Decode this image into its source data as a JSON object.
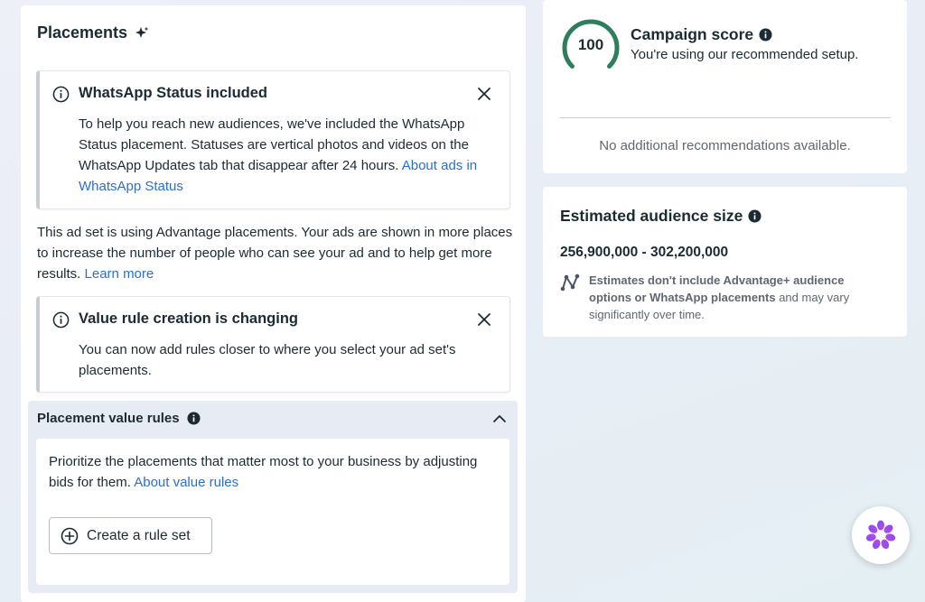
{
  "placements": {
    "title": "Placements",
    "whatsapp_notice": {
      "title": "WhatsApp Status included",
      "body": "To help you reach new audiences, we've included the WhatsApp Status placement. Statuses are vertical photos and videos on the WhatsApp Updates tab that disappear after 24 hours.",
      "link": "About ads in WhatsApp Status"
    },
    "advantage_text": "This ad set is using Advantage placements. Your ads are shown in more places to increase the number of people who can see your ad and to help get more results.",
    "advantage_link": "Learn more",
    "value_rule_notice": {
      "title": "Value rule creation is changing",
      "body": "You can now add rules closer to where you select your ad set's placements."
    },
    "value_rules": {
      "title": "Placement value rules",
      "description": "Prioritize the placements that matter most to your business by adjusting bids for them.",
      "link": "About value rules",
      "button_label": "Create a rule set"
    }
  },
  "campaign_score": {
    "score": "100",
    "score_fraction": 1.0,
    "title": "Campaign score",
    "subtitle": "You're using our recommended setup.",
    "no_recommendations": "No additional recommendations available."
  },
  "audience": {
    "title": "Estimated audience size",
    "range": "256,900,000 - 302,200,000",
    "note_prefix": "Estimates don't include Advantage+ audience options or WhatsApp placements",
    "note_suffix": " and may vary significantly over time."
  },
  "colors": {
    "score_ring": "#2e7d5b",
    "link": "#2a6fd1",
    "ai_gradient_start": "#7b4dff",
    "ai_gradient_end": "#c04bd6"
  }
}
